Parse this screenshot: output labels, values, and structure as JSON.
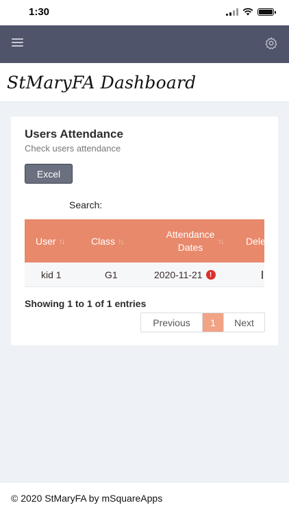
{
  "status_bar": {
    "time": "1:30"
  },
  "header": {
    "menu_icon": "hamburger-icon",
    "settings_icon": "gear-icon"
  },
  "title": "StMaryFA Dashboard",
  "card": {
    "title": "Users Attendance",
    "subtitle": "Check users attendance",
    "excel_label": "Excel",
    "search_label": "Search:",
    "table": {
      "columns": [
        "User",
        "Class",
        "Attendance Dates",
        "Dele"
      ],
      "attendance_header_line1": "Attendance",
      "attendance_header_line2": "Dates",
      "rows": [
        {
          "user": "kid 1",
          "class": "G1",
          "date": "2020-11-21",
          "status_icon": "alert-icon"
        }
      ]
    },
    "showing_text": "Showing 1 to 1 of 1 entries",
    "pagination": {
      "previous": "Previous",
      "current": "1",
      "next": "Next"
    }
  },
  "footer": {
    "text": "© 2020 StMaryFA by mSquareApps"
  },
  "colors": {
    "header_bg": "#50546a",
    "table_header": "#e8896b",
    "active_page": "#f0a385",
    "alert": "#d9322b",
    "excel_button": "#6b7080"
  }
}
